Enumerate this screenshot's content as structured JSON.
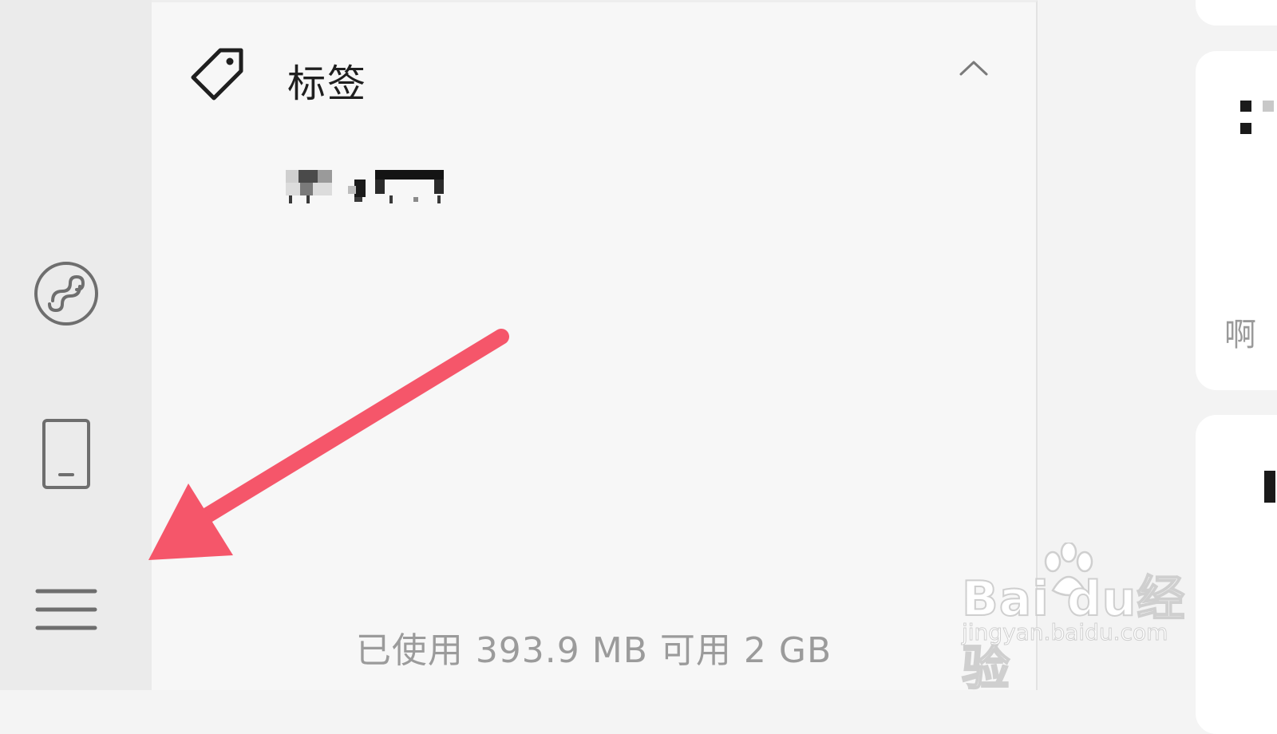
{
  "panel": {
    "title": "标签",
    "storage_text": "已使用 393.9 MB 可用 2 GB"
  },
  "right": {
    "card_text": "啊"
  },
  "watermark": {
    "logo": "Bai du经验",
    "url": "jingyan.baidu.com"
  },
  "icons": {
    "tag": "tag-icon",
    "collapse": "chevron-up-icon",
    "mini_program": "mini-program-icon",
    "device": "phone-icon",
    "menu": "menu-icon"
  },
  "colors": {
    "annotation_arrow": "#f5566a",
    "rail_background": "#ebebeb",
    "panel_background": "#f7f7f7"
  }
}
